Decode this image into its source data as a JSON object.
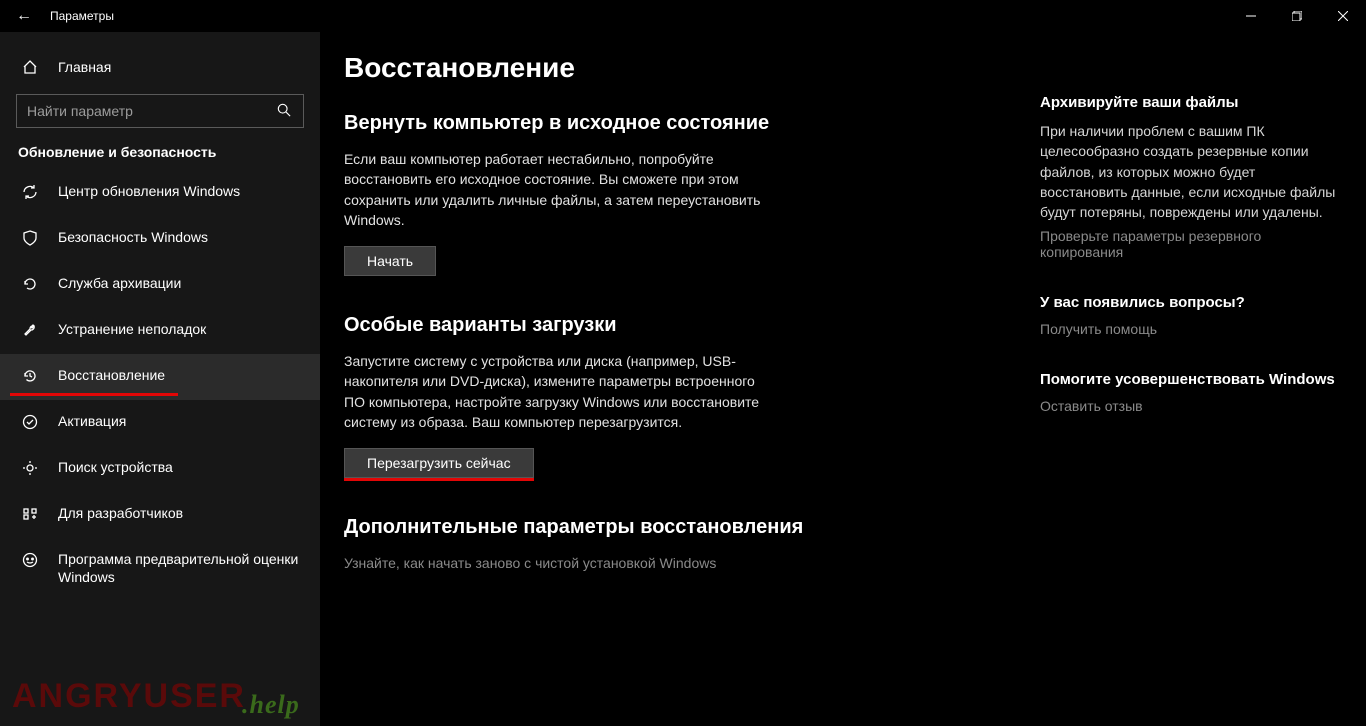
{
  "window": {
    "title": "Параметры"
  },
  "sidebar": {
    "home": "Главная",
    "search_placeholder": "Найти параметр",
    "category": "Обновление и безопасность",
    "items": [
      {
        "label": "Центр обновления Windows"
      },
      {
        "label": "Безопасность Windows"
      },
      {
        "label": "Служба архивации"
      },
      {
        "label": "Устранение неполадок"
      },
      {
        "label": "Восстановление"
      },
      {
        "label": "Активация"
      },
      {
        "label": "Поиск устройства"
      },
      {
        "label": "Для разработчиков"
      },
      {
        "label": "Программа предварительной оценки Windows"
      }
    ]
  },
  "main": {
    "page_title": "Восстановление",
    "section1": {
      "title": "Вернуть компьютер в исходное состояние",
      "body": "Если ваш компьютер работает нестабильно, попробуйте восстановить его исходное состояние. Вы сможете при этом сохранить или удалить личные файлы, а затем переустановить Windows.",
      "button": "Начать"
    },
    "section2": {
      "title": "Особые варианты загрузки",
      "body": "Запустите систему с устройства или диска (например, USB-накопителя или DVD-диска), измените параметры встроенного ПО компьютера, настройте загрузку Windows или восстановите систему из образа. Ваш компьютер перезагрузится.",
      "button": "Перезагрузить сейчас"
    },
    "section3": {
      "title": "Дополнительные параметры восстановления",
      "body": "Узнайте, как начать заново с чистой установкой Windows"
    }
  },
  "aside": {
    "block1": {
      "title": "Архивируйте ваши файлы",
      "body": "При наличии проблем с вашим ПК целесообразно создать резервные копии файлов, из которых можно будет восстановить данные, если исходные файлы будут потеряны, повреждены или удалены.",
      "link": "Проверьте параметры резервного копирования"
    },
    "block2": {
      "title": "У вас появились вопросы?",
      "link": "Получить помощь"
    },
    "block3": {
      "title": "Помогите усовершенствовать Windows",
      "link": "Оставить отзыв"
    }
  },
  "watermark": {
    "a": "ANGRYUSER",
    "b": ".help"
  }
}
